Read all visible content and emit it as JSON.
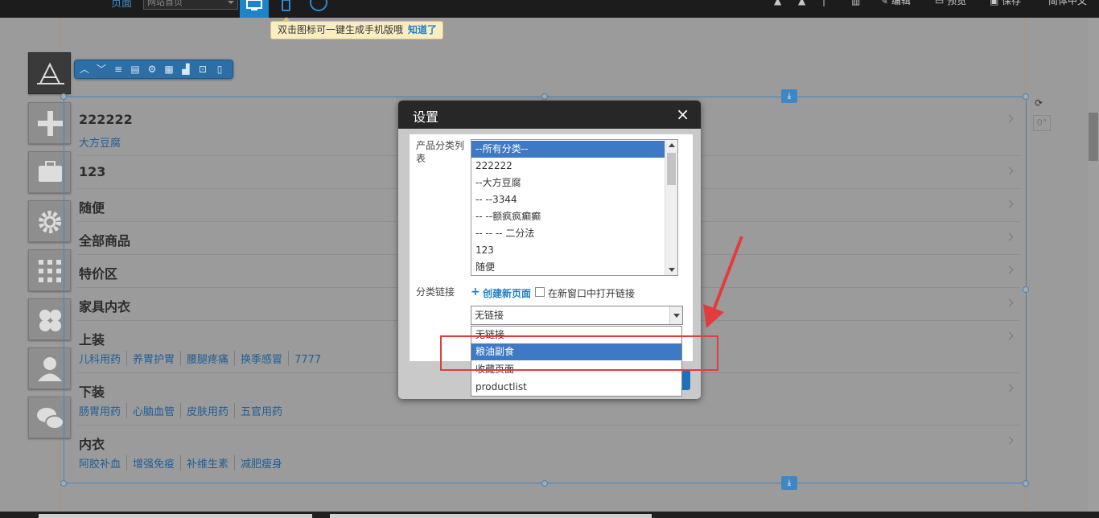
{
  "topbar": {
    "page_label": "页面",
    "page_select": "网站首页",
    "tools": [
      "编辑",
      "预览",
      "保存",
      "简体中文"
    ]
  },
  "tooltip": {
    "text": "双击图标可一键生成手机版哦",
    "ok": "知道了"
  },
  "categories": [
    {
      "title": "222222",
      "subs": [
        "大方豆腐"
      ]
    },
    {
      "title": "123",
      "subs": []
    },
    {
      "title": "随便",
      "subs": []
    },
    {
      "title": "全部商品",
      "subs": []
    },
    {
      "title": "特价区",
      "subs": []
    },
    {
      "title": "家具内衣",
      "subs": []
    },
    {
      "title": "上装",
      "subs": [
        "儿科用药",
        "养胃护胃",
        "腰腿疼痛",
        "换季感冒",
        "7777"
      ]
    },
    {
      "title": "下装",
      "subs": [
        "肠胃用药",
        "心脑血管",
        "皮肤用药",
        "五官用药"
      ]
    },
    {
      "title": "内衣",
      "subs": [
        "阿胶补血",
        "增强免疫",
        "补维生素",
        "减肥瘦身"
      ]
    }
  ],
  "side": {
    "deg": "0°"
  },
  "dialog": {
    "title": "设置",
    "close": "×",
    "category_list_label": "产品分类列表",
    "category_options": [
      "--所有分类--",
      "222222",
      "--大方豆腐",
      "-- --3344",
      "-- --额疯疯癫癫",
      "-- -- -- 二分法",
      "123",
      "随便"
    ],
    "category_link_label": "分类链接",
    "create_page": "创建新页面",
    "open_new_window": "在新窗口中打开链接",
    "link_value": "无链接",
    "link_options": [
      "无链接",
      "粮油副食",
      "收藏页面",
      "productlist"
    ]
  }
}
